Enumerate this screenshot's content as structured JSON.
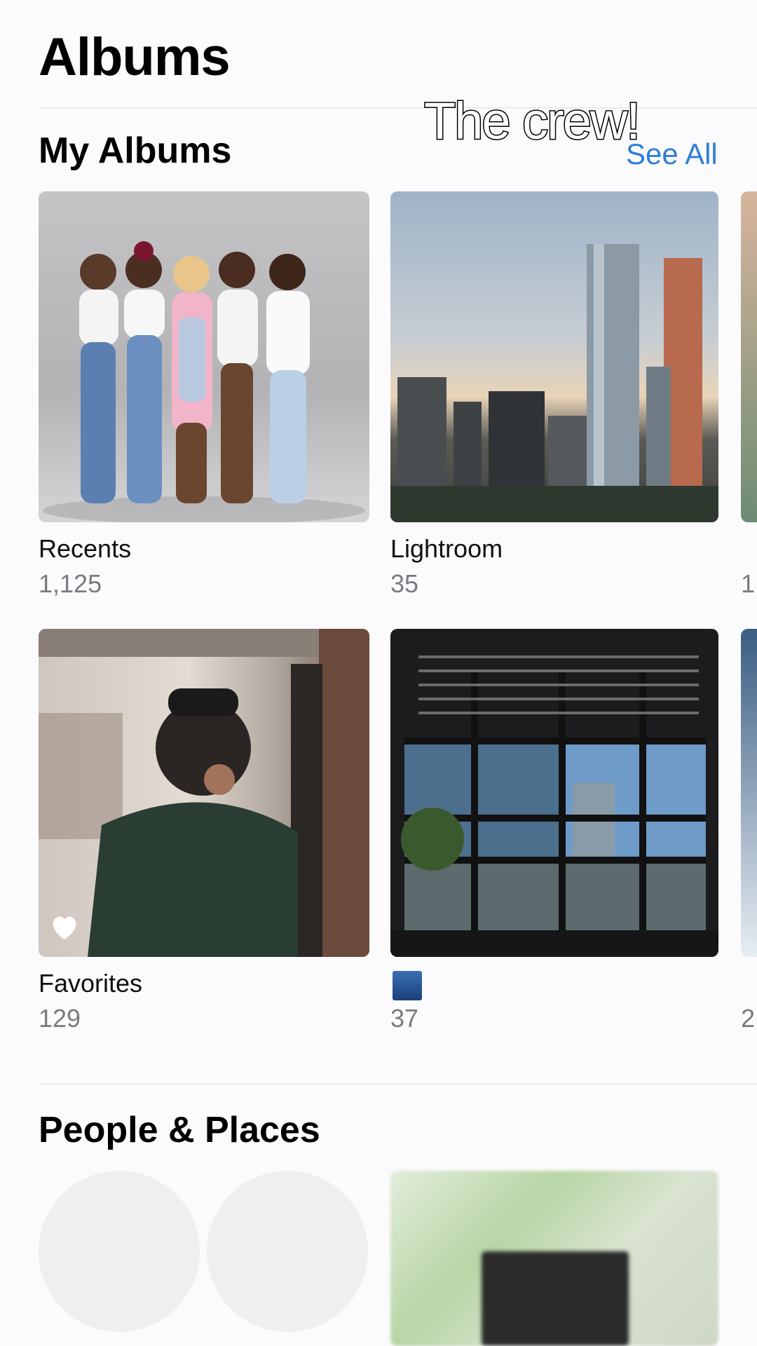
{
  "header": {
    "title": "Albums"
  },
  "overlay_caption": "The crew!",
  "my_albums": {
    "title": "My Albums",
    "see_all": "See All",
    "albums": [
      {
        "name": "Recents",
        "count": "1,125"
      },
      {
        "name": "Lightroom",
        "count": "35"
      },
      {
        "name": "Favorites",
        "count": "129"
      },
      {
        "name": "",
        "count": "37"
      }
    ],
    "partial_counts": [
      "1",
      "2"
    ]
  },
  "people_places": {
    "title": "People & Places"
  },
  "colors": {
    "accent": "#2f7fd8",
    "background": "#fbfbfd"
  },
  "icons": [
    "heart-icon"
  ]
}
